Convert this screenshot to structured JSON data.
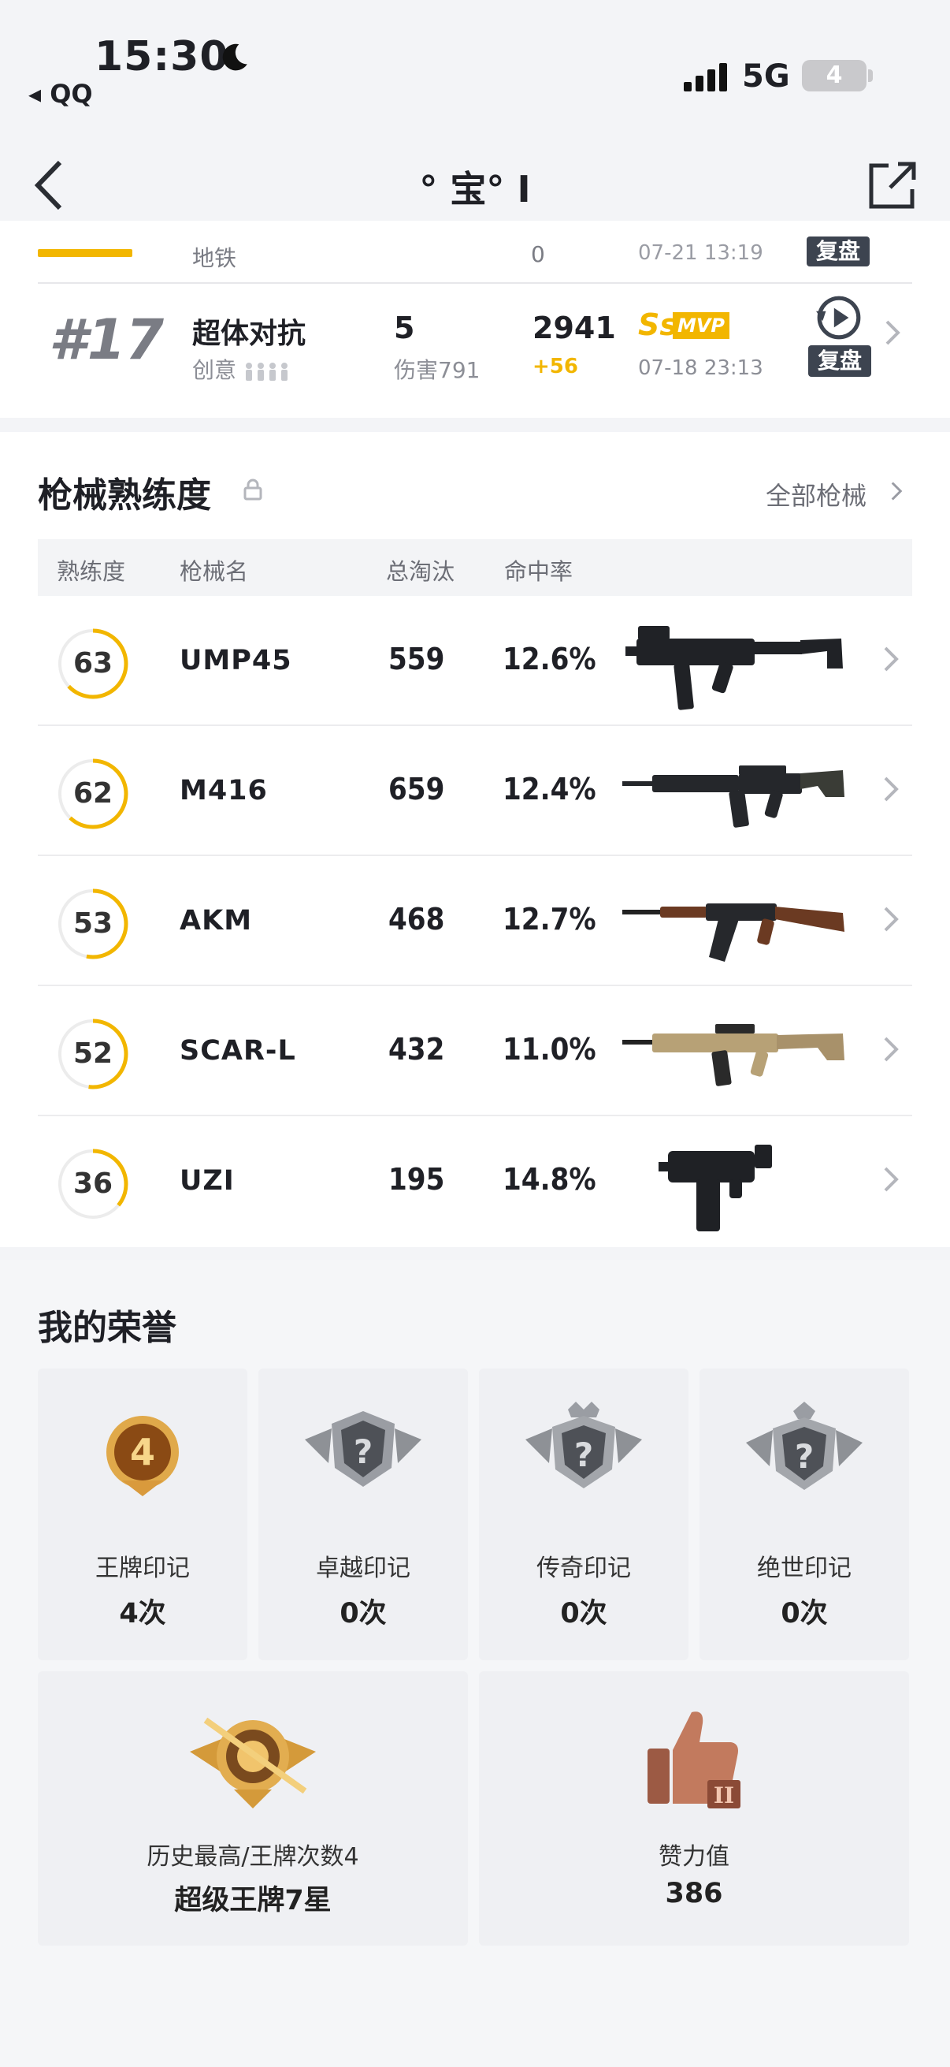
{
  "status_bar": {
    "time": "15:30",
    "back_app": "◂ QQ",
    "network": "5G",
    "battery": "4"
  },
  "nav": {
    "title": "° 宝° I"
  },
  "matches": [
    {
      "mode": "地铁",
      "kills": "0",
      "time": "07-21 13:19",
      "replay_label": "复盘"
    },
    {
      "rank": "#17",
      "mode": "超体对抗",
      "sub": "创意",
      "kills": "5",
      "damage": "伤害791",
      "score": "2941",
      "score_delta": "+56",
      "grade": "Ss",
      "badge": "MVP",
      "time": "07-18 23:13",
      "replay_label": "复盘"
    }
  ],
  "weapons": {
    "title": "枪械熟练度",
    "all_link": "全部枪械",
    "headers": {
      "mastery": "熟练度",
      "name": "枪械名",
      "kills": "总淘汰",
      "accuracy": "命中率"
    },
    "rows": [
      {
        "mastery": "63",
        "mastery_value": 63,
        "name": "UMP45",
        "kills": "559",
        "accuracy": "12.6%"
      },
      {
        "mastery": "62",
        "mastery_value": 62,
        "name": "M416",
        "kills": "659",
        "accuracy": "12.4%"
      },
      {
        "mastery": "53",
        "mastery_value": 53,
        "name": "AKM",
        "kills": "468",
        "accuracy": "12.7%"
      },
      {
        "mastery": "52",
        "mastery_value": 52,
        "name": "SCAR-L",
        "kills": "432",
        "accuracy": "11.0%"
      },
      {
        "mastery": "36",
        "mastery_value": 36,
        "name": "UZI",
        "kills": "195",
        "accuracy": "14.8%"
      }
    ]
  },
  "honors": {
    "title": "我的荣誉",
    "marks": [
      {
        "label": "王牌印记",
        "value": "4次",
        "badge": "4"
      },
      {
        "label": "卓越印记",
        "value": "0次",
        "badge": "?"
      },
      {
        "label": "传奇印记",
        "value": "0次",
        "badge": "?"
      },
      {
        "label": "绝世印记",
        "value": "0次",
        "badge": "?"
      }
    ],
    "best": {
      "label": "历史最高/王牌次数4",
      "value": "超级王牌7星"
    },
    "likes": {
      "label": "赞力值",
      "value": "386",
      "badge": "II"
    }
  },
  "colors": {
    "accent": "#f2b600",
    "ring_track": "#ececec",
    "badge_dark": "#3d4450"
  }
}
